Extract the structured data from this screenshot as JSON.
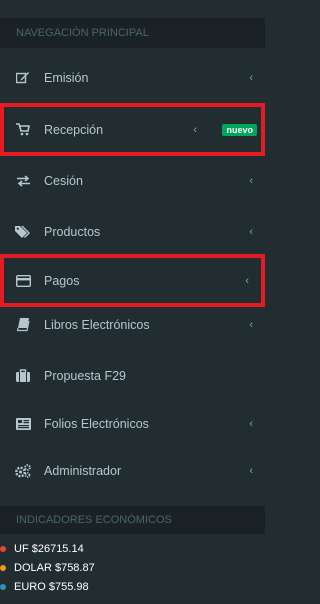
{
  "sections": {
    "main_nav": "NAVEGACIÓN PRINCIPAL",
    "indicators": "INDICADORES ECONÓMICOS"
  },
  "menu": [
    {
      "label": "Emisión",
      "icon": "edit-icon"
    },
    {
      "label": "Recepción",
      "icon": "cart-icon",
      "badge": "nuevo"
    },
    {
      "label": "Cesión",
      "icon": "exchange-icon"
    },
    {
      "label": "Productos",
      "icon": "tags-icon"
    },
    {
      "label": "Pagos",
      "icon": "credit-card-icon"
    },
    {
      "label": "Libros Electrónicos",
      "icon": "book-icon"
    },
    {
      "label": "Propuesta F29",
      "icon": "briefcase-icon"
    },
    {
      "label": "Folios Electrónicos",
      "icon": "newspaper-icon"
    },
    {
      "label": "Administrador",
      "icon": "cogs-icon"
    }
  ],
  "indicators": [
    {
      "text": "UF $26715.14"
    },
    {
      "text": "DOLAR $758.87"
    },
    {
      "text": "EURO $755.98"
    }
  ],
  "chevron": "‹",
  "colors": {
    "sidebar_bg": "#222d32",
    "header_bg": "#1a2226",
    "highlight": "#e31c23",
    "badge": "#00a65a"
  }
}
